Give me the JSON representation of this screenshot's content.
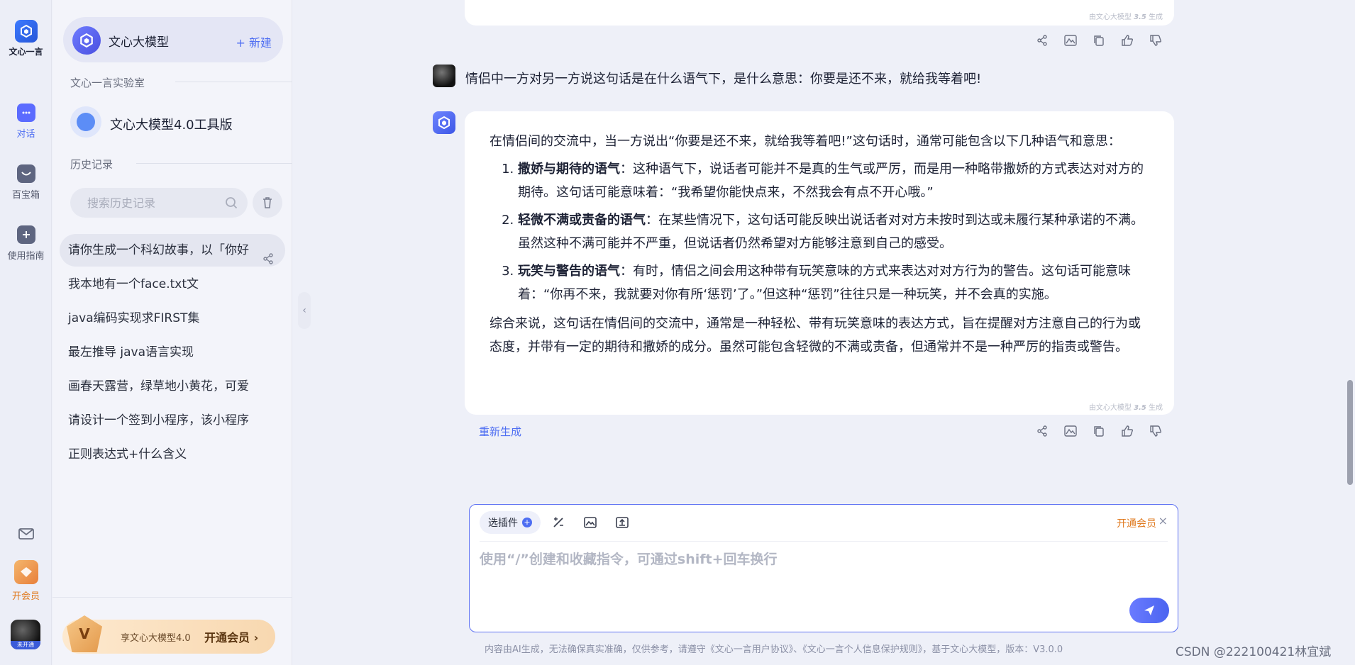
{
  "rail": {
    "logo_text": "文心一言",
    "items": [
      {
        "label": "对话"
      },
      {
        "label": "百宝箱"
      },
      {
        "label": "使用指南"
      }
    ],
    "vip_label": "开会员",
    "avatar_tag": "未开通"
  },
  "sidebar": {
    "model_name": "文心大模型",
    "new_label": "+ 新建",
    "lab_label": "文心一言实验室",
    "tool_item": "文心大模型4.0工具版",
    "history_label": "历史记录",
    "search_placeholder": "搜索历史记录",
    "history": [
      "请你生成一个科幻故事，以「你好",
      "我本地有一个face.txt文",
      "java编码实现求FIRST集",
      "最左推导 java语言实现",
      "画春天露营，绿草地小黄花，可爱",
      "请设计一个签到小程序，该小程序",
      "正则表达式+什么含义"
    ],
    "vip_banner": {
      "text": "享文心大模型4.0",
      "cta": "开通会员 ›"
    }
  },
  "chat": {
    "gen_note_prefix": "由文心大模型",
    "gen_note_version": "3.5",
    "gen_note_suffix": "生成",
    "user_message": "情侣中一方对另一方说这句话是在什么语气下，是什么意思：你要是还不来，就给我等着吧!",
    "answer": {
      "intro": "在情侣间的交流中，当一方说出“你要是还不来，就给我等着吧!”这句话时，通常可能包含以下几种语气和意思：",
      "points": [
        {
          "title": "撒娇与期待的语气",
          "text": "：这种语气下，说话者可能并不是真的生气或严厉，而是用一种略带撒娇的方式表达对对方的期待。这句话可能意味着：“我希望你能快点来，不然我会有点不开心哦。”"
        },
        {
          "title": "轻微不满或责备的语气",
          "text": "：在某些情况下，这句话可能反映出说话者对对方未按时到达或未履行某种承诺的不满。虽然这种不满可能并不严重，但说话者仍然希望对方能够注意到自己的感受。"
        },
        {
          "title": "玩笑与警告的语气",
          "text": "：有时，情侣之间会用这种带有玩笑意味的方式来表达对对方行为的警告。这句话可能意味着：“你再不来，我就要对你有所‘惩罚’了。”但这种“惩罚”往往只是一种玩笑，并不会真的实施。"
        }
      ],
      "summary": "综合来说，这句话在情侣间的交流中，通常是一种轻松、带有玩笑意味的表达方式，旨在提醒对方注意自己的行为或态度，并带有一定的期待和撒娇的成分。虽然可能包含轻微的不满或责备，但通常并不是一种严厉的指责或警告。"
    },
    "regenerate": "重新生成"
  },
  "composer": {
    "plugin_label": "选插件",
    "vip_link": "开通会员",
    "close": "×",
    "placeholder": "使用“/”创建和收藏指令，可通过shift+回车换行"
  },
  "footer": {
    "note": "内容由AI生成，无法确保真实准确，仅供参考，请遵守《文心一言用户协议》、《文心一言个人信息保护规则》，基于文心大模型，版本：V3.0.0",
    "watermark": "CSDN @222100421林宜斌"
  },
  "colors": {
    "accent": "#4e6ef2",
    "vip": "#e07a1f",
    "background": "#eef0f8"
  }
}
